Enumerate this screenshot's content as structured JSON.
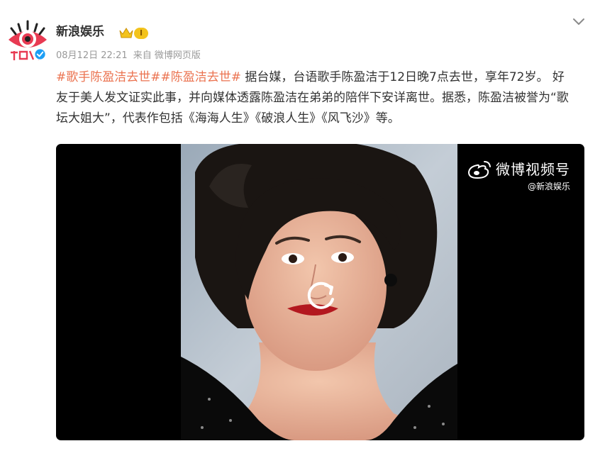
{
  "post": {
    "username": "新浪娱乐",
    "level": "I",
    "timestamp": "08月12日 22:21",
    "source": "来自 微博网页版",
    "hashtags": [
      "#歌手陈盈洁去世#",
      "#陈盈洁去世#"
    ],
    "body": " 据台媒，台语歌手陈盈洁于12日晚7点去世，享年72岁。 好友于美人发文证实此事，并向媒体透露陈盈洁在弟弟的陪伴下安详离世。据悉，陈盈洁被誉为“歌坛大姐大”，代表作包括《海海人生》《破浪人生》《风飞沙》等。"
  },
  "video": {
    "watermark_title": "微博视频号",
    "watermark_account": "@新浪娱乐"
  },
  "icons": {
    "avatar": "sina-eye-logo",
    "verified": "verified-badge-icon",
    "vip": "crown-icon",
    "more": "chevron-down-icon",
    "replay": "replay-icon",
    "weibo": "weibo-logo-icon"
  },
  "colors": {
    "hashtag": "#eb7350",
    "meta": "#999999",
    "text": "#333333",
    "badge_gold": "#f3c31c"
  }
}
